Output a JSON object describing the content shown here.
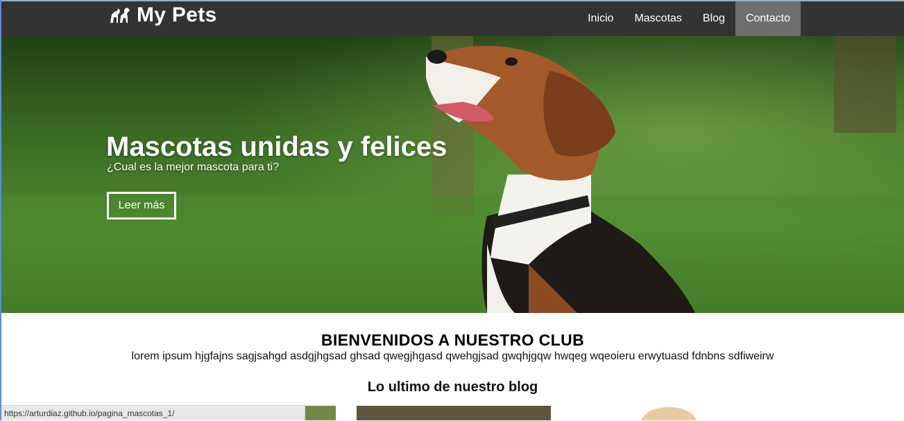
{
  "brand": {
    "name": "My Pets",
    "icon": "dog-cat-icon"
  },
  "nav": {
    "items": [
      {
        "label": "Inicio",
        "active": false
      },
      {
        "label": "Mascotas",
        "active": false
      },
      {
        "label": "Blog",
        "active": false
      },
      {
        "label": "Contacto",
        "active": true
      }
    ]
  },
  "hero": {
    "title": "Mascotas unidas y felices",
    "subtitle": "¿Cual es la mejor mascota para ti?",
    "button_label": "Leer más"
  },
  "welcome": {
    "title": "BIENVENIDOS A NUESTRO CLUB",
    "text": "lorem ipsum hjgfajns sagjsahgd asdgjhgsad ghsad qwegjhgasd qwehgjsad gwqhjgqw hwqeg wqeoieru erwytuasd fdnbns sdfiweirw"
  },
  "blog": {
    "title": "Lo ultimo de nuestro blog"
  },
  "status_bar": {
    "url": "https://arturdiaz.github.io/pagina_mascotas_1/"
  },
  "colors": {
    "navbar": "#333333",
    "nav_active": "#6f6f6f",
    "grass": "#4a8230"
  }
}
